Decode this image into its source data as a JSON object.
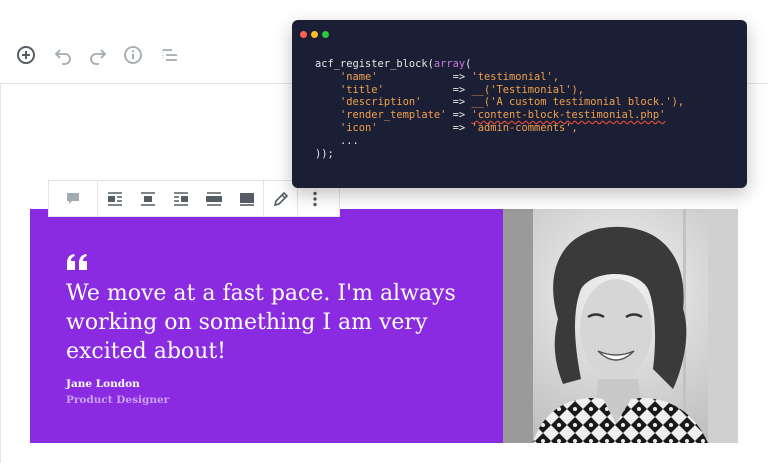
{
  "top_toolbar": {
    "icons": [
      "add-block-icon",
      "undo-icon",
      "redo-icon",
      "info-icon",
      "block-navigation-icon"
    ]
  },
  "block_toolbar": {
    "icons": [
      "testimonial-block-icon",
      "align-left-icon",
      "align-center-icon",
      "align-right-icon",
      "wide-width-icon",
      "full-width-icon",
      "edit-pencil-icon",
      "more-options-icon"
    ]
  },
  "testimonial": {
    "quote": "We move at a fast pace. I'm always working on something I am very excited about!",
    "name": "Jane London",
    "role": "Product Designer",
    "background_color": "#8a2be2"
  },
  "code_window": {
    "dots": [
      "#ff5f56",
      "#ffbd2e",
      "#27c93f"
    ],
    "line1_fn": "acf_register_block",
    "line1_kw": "array",
    "line1_open": "(",
    "rows": [
      {
        "key": "'name'",
        "arrow": "=>",
        "value": "'testimonial',"
      },
      {
        "key": "'title'",
        "arrow": "=>",
        "value": "__('Testimonial'),"
      },
      {
        "key": "'description'",
        "arrow": "=>",
        "value": "__('A custom testimonial block.'),"
      },
      {
        "key": "'render_template'",
        "arrow": "=>",
        "value": "'content-block-testimonial.php'"
      },
      {
        "key": "'icon'",
        "arrow": "=>",
        "value": "'admin-comments',"
      }
    ],
    "ellipsis": "...",
    "closing": "));"
  }
}
